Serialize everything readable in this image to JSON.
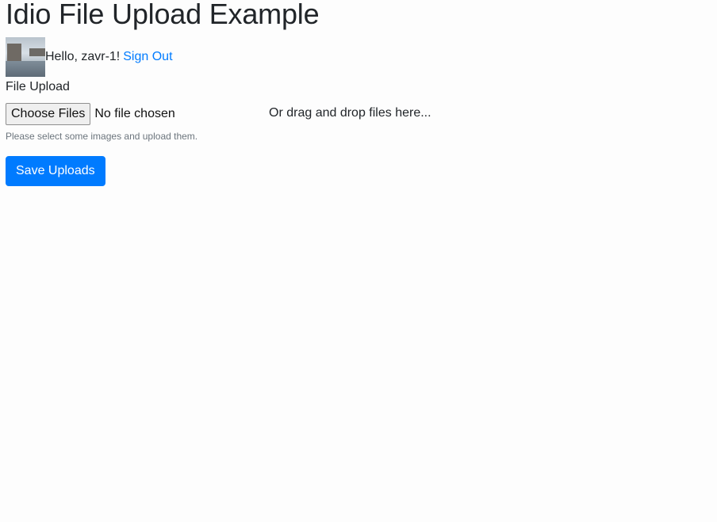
{
  "header": {
    "title": "Idio File Upload Example"
  },
  "user": {
    "greeting": "Hello, zavr-1!",
    "sign_out_label": "Sign Out",
    "avatar_icon": "user-avatar-photo"
  },
  "upload": {
    "label": "File Upload",
    "choose_button_label": "Choose Files",
    "no_file_text": "No file chosen",
    "drop_text": "Or drag and drop files here...",
    "help_text": "Please select some images and upload them."
  },
  "actions": {
    "save_label": "Save Uploads"
  },
  "colors": {
    "primary": "#007bff",
    "text": "#212529",
    "muted": "#6c757d",
    "background": "#fdfdfd"
  }
}
